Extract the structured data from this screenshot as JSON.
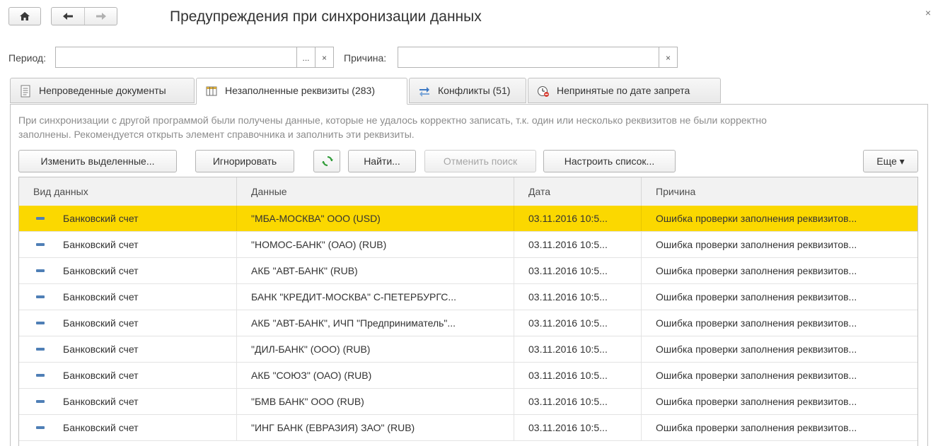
{
  "window": {
    "title": "Предупреждения при синхронизации данных",
    "close": "×"
  },
  "filters": {
    "period_label": "Период:",
    "period_value": "",
    "period_select": "...",
    "period_clear": "×",
    "reason_label": "Причина:",
    "reason_value": "",
    "reason_clear": "×"
  },
  "tabs": [
    {
      "label": "Непроведенные документы",
      "icon": "document-icon",
      "active": false
    },
    {
      "label": "Незаполненные реквизиты (283)",
      "icon": "table-columns-icon",
      "active": true
    },
    {
      "label": "Конфликты (51)",
      "icon": "sync-conflict-icon",
      "active": false
    },
    {
      "label": "Непринятые по дате запрета",
      "icon": "clock-forbidden-icon",
      "active": false
    }
  ],
  "hint_text": "При синхронизации с другой программой были получены данные, которые не удалось корректно записать, т.к. один или несколько реквизитов не были корректно заполнены. Рекомендуется открыть элемент справочника и заполнить эти реквизиты.",
  "toolbar": {
    "change_selected": "Изменить выделенные...",
    "ignore": "Игнорировать",
    "refresh_icon": "refresh-icon",
    "find": "Найти...",
    "cancel_search": "Отменить поиск",
    "configure_list": "Настроить список...",
    "more": "Еще ▾"
  },
  "table": {
    "columns": [
      "Вид данных",
      "Данные",
      "Дата",
      "Причина"
    ],
    "rows": [
      {
        "type": "Банковский счет",
        "data": "\"МБА-МОСКВА\" ООО (USD)",
        "date": "03.11.2016 10:5...",
        "reason": "Ошибка проверки заполнения реквизитов...",
        "selected": true
      },
      {
        "type": "Банковский счет",
        "data": "\"НОМОС-БАНК\" (ОАО) (RUB)",
        "date": "03.11.2016 10:5...",
        "reason": "Ошибка проверки заполнения реквизитов...",
        "selected": false
      },
      {
        "type": "Банковский счет",
        "data": "АКБ \"АВТ-БАНК\" (RUB)",
        "date": "03.11.2016 10:5...",
        "reason": "Ошибка проверки заполнения реквизитов...",
        "selected": false
      },
      {
        "type": "Банковский счет",
        "data": "БАНК \"КРЕДИТ-МОСКВА\" С-ПЕТЕРБУРГС...",
        "date": "03.11.2016 10:5...",
        "reason": "Ошибка проверки заполнения реквизитов...",
        "selected": false
      },
      {
        "type": "Банковский счет",
        "data": "АКБ \"АВТ-БАНК\", ИЧП \"Предприниматель\"...",
        "date": "03.11.2016 10:5...",
        "reason": "Ошибка проверки заполнения реквизитов...",
        "selected": false
      },
      {
        "type": "Банковский счет",
        "data": "\"ДИЛ-БАНК\" (ООО) (RUB)",
        "date": "03.11.2016 10:5...",
        "reason": "Ошибка проверки заполнения реквизитов...",
        "selected": false
      },
      {
        "type": "Банковский счет",
        "data": "АКБ \"СОЮЗ\" (ОАО) (RUB)",
        "date": "03.11.2016 10:5...",
        "reason": "Ошибка проверки заполнения реквизитов...",
        "selected": false
      },
      {
        "type": "Банковский счет",
        "data": "\"БМВ БАНК\" ООО (RUB)",
        "date": "03.11.2016 10:5...",
        "reason": "Ошибка проверки заполнения реквизитов...",
        "selected": false
      },
      {
        "type": "Банковский счет",
        "data": "\"ИНГ БАНК (ЕВРАЗИЯ) ЗАО\" (RUB)",
        "date": "03.11.2016 10:5...",
        "reason": "Ошибка проверки заполнения реквизитов...",
        "selected": false
      }
    ]
  },
  "colors": {
    "selection": "#fbd800",
    "hint_text": "#8c8c8c",
    "row_icon": "#4f7fb6"
  }
}
